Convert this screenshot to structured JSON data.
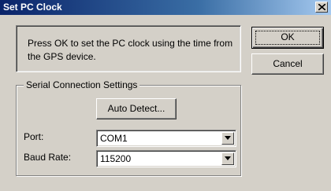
{
  "window": {
    "title": "Set PC Clock",
    "close_icon": "close-icon"
  },
  "message": "Press OK to set the PC clock using the time from the GPS device.",
  "buttons": {
    "ok": "OK",
    "cancel": "Cancel",
    "auto_detect": "Auto Detect..."
  },
  "serial_settings": {
    "group_label": "Serial Connection Settings",
    "port": {
      "label": "Port:",
      "value": "COM1"
    },
    "baud_rate": {
      "label": "Baud Rate:",
      "value": "115200"
    }
  },
  "colors": {
    "face": "#d4d0c8",
    "title_start": "#0a246a",
    "title_end": "#a6caf0"
  }
}
